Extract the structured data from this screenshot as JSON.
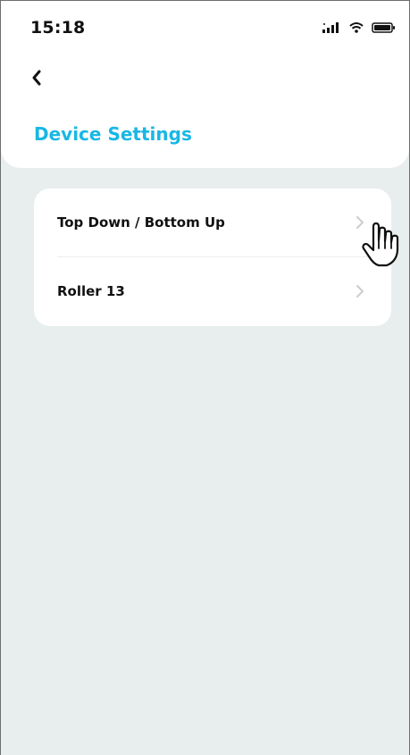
{
  "status_bar": {
    "time": "15:18",
    "icons": [
      "signal-icon",
      "wifi-icon",
      "battery-icon"
    ]
  },
  "header": {
    "back_icon": "chevron-left-icon",
    "title": "Device Settings"
  },
  "settings": {
    "items": [
      {
        "label": "Top Down / Bottom Up",
        "icon": "chevron-right-icon"
      },
      {
        "label": "Roller 13",
        "icon": "chevron-right-icon"
      }
    ]
  },
  "colors": {
    "accent": "#19b7e4",
    "background": "#e8eeee",
    "card": "#ffffff",
    "text": "#111111"
  }
}
